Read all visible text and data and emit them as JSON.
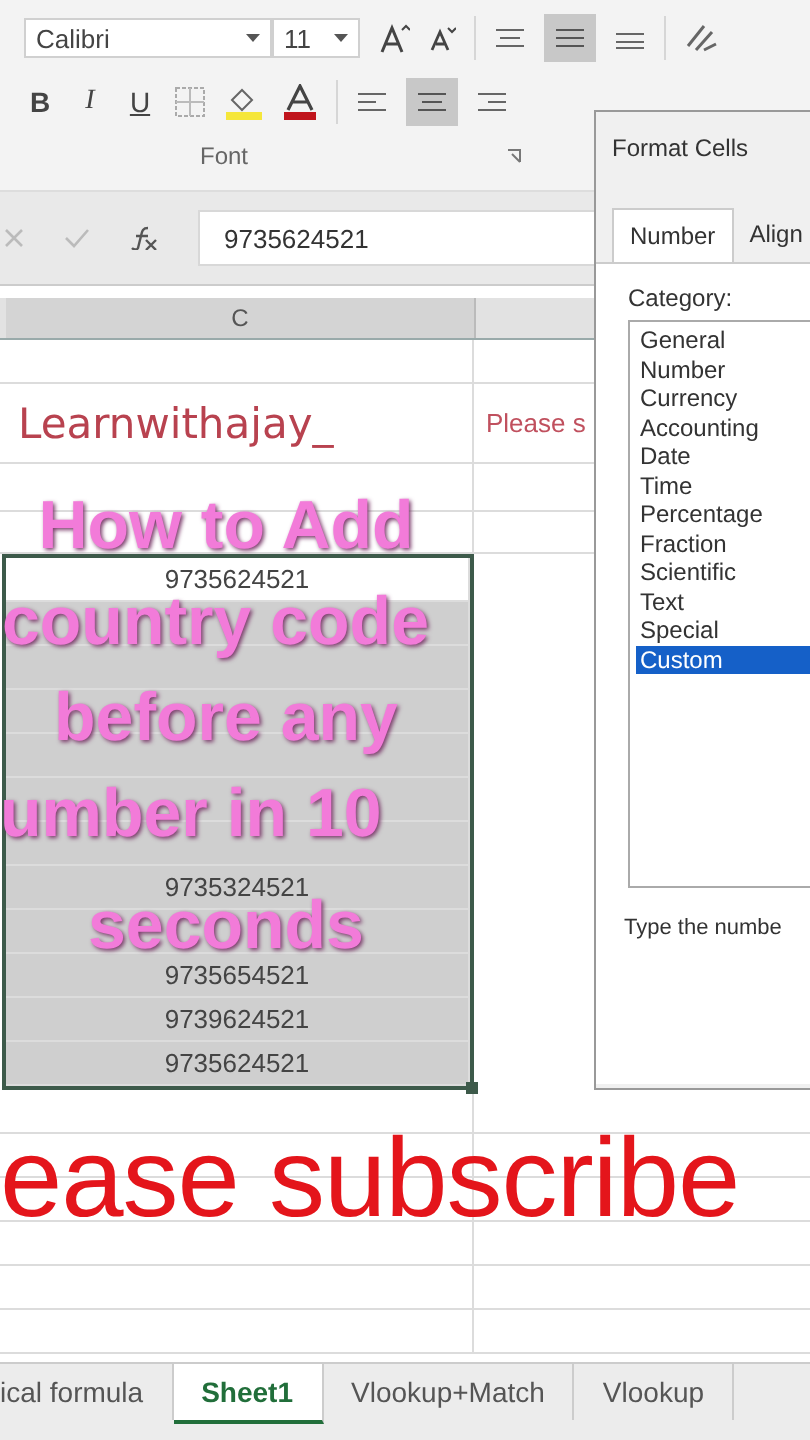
{
  "ribbon": {
    "font_name": "Calibri",
    "font_size": "11",
    "format_buttons": [
      "B",
      "I",
      "U"
    ],
    "group_label": "Font"
  },
  "formula_bar": {
    "value": "9735624521"
  },
  "column_header": "C",
  "cells": {
    "title": "Learnwithajay_",
    "note": "Please s"
  },
  "numbers": [
    {
      "value": "9735624521",
      "active": true
    },
    {
      "active": false
    },
    {
      "active": false
    },
    {
      "active": false
    },
    {
      "active": false
    },
    {
      "active": false
    },
    {
      "active": false
    },
    {
      "value": "9735324521",
      "active": false
    },
    {
      "active": false
    },
    {
      "value": "9735654521",
      "active": false
    },
    {
      "value": "9739624521",
      "active": false
    },
    {
      "value": "9735624521",
      "active": false
    }
  ],
  "overlay_text": [
    "How to Add",
    "country code",
    "before any",
    "umber in 10",
    "seconds"
  ],
  "banner": "ease subscribe",
  "sheet_tabs": [
    {
      "label": "ical formula",
      "selected": false
    },
    {
      "label": "Sheet1",
      "selected": true
    },
    {
      "label": "Vlookup+Match",
      "selected": false
    },
    {
      "label": "Vlookup",
      "selected": false
    }
  ],
  "dialog": {
    "title": "Format Cells",
    "tabs": [
      {
        "label": "Number",
        "selected": true
      },
      {
        "label": "Align",
        "selected": false
      }
    ],
    "category_label": "Category:",
    "categories": [
      {
        "label": "General",
        "selected": false
      },
      {
        "label": "Number",
        "selected": false
      },
      {
        "label": "Currency",
        "selected": false
      },
      {
        "label": "Accounting",
        "selected": false
      },
      {
        "label": "Date",
        "selected": false
      },
      {
        "label": "Time",
        "selected": false
      },
      {
        "label": "Percentage",
        "selected": false
      },
      {
        "label": "Fraction",
        "selected": false
      },
      {
        "label": "Scientific",
        "selected": false
      },
      {
        "label": "Text",
        "selected": false
      },
      {
        "label": "Special",
        "selected": false
      },
      {
        "label": "Custom",
        "selected": true
      }
    ],
    "hint": "Type the numbe"
  }
}
